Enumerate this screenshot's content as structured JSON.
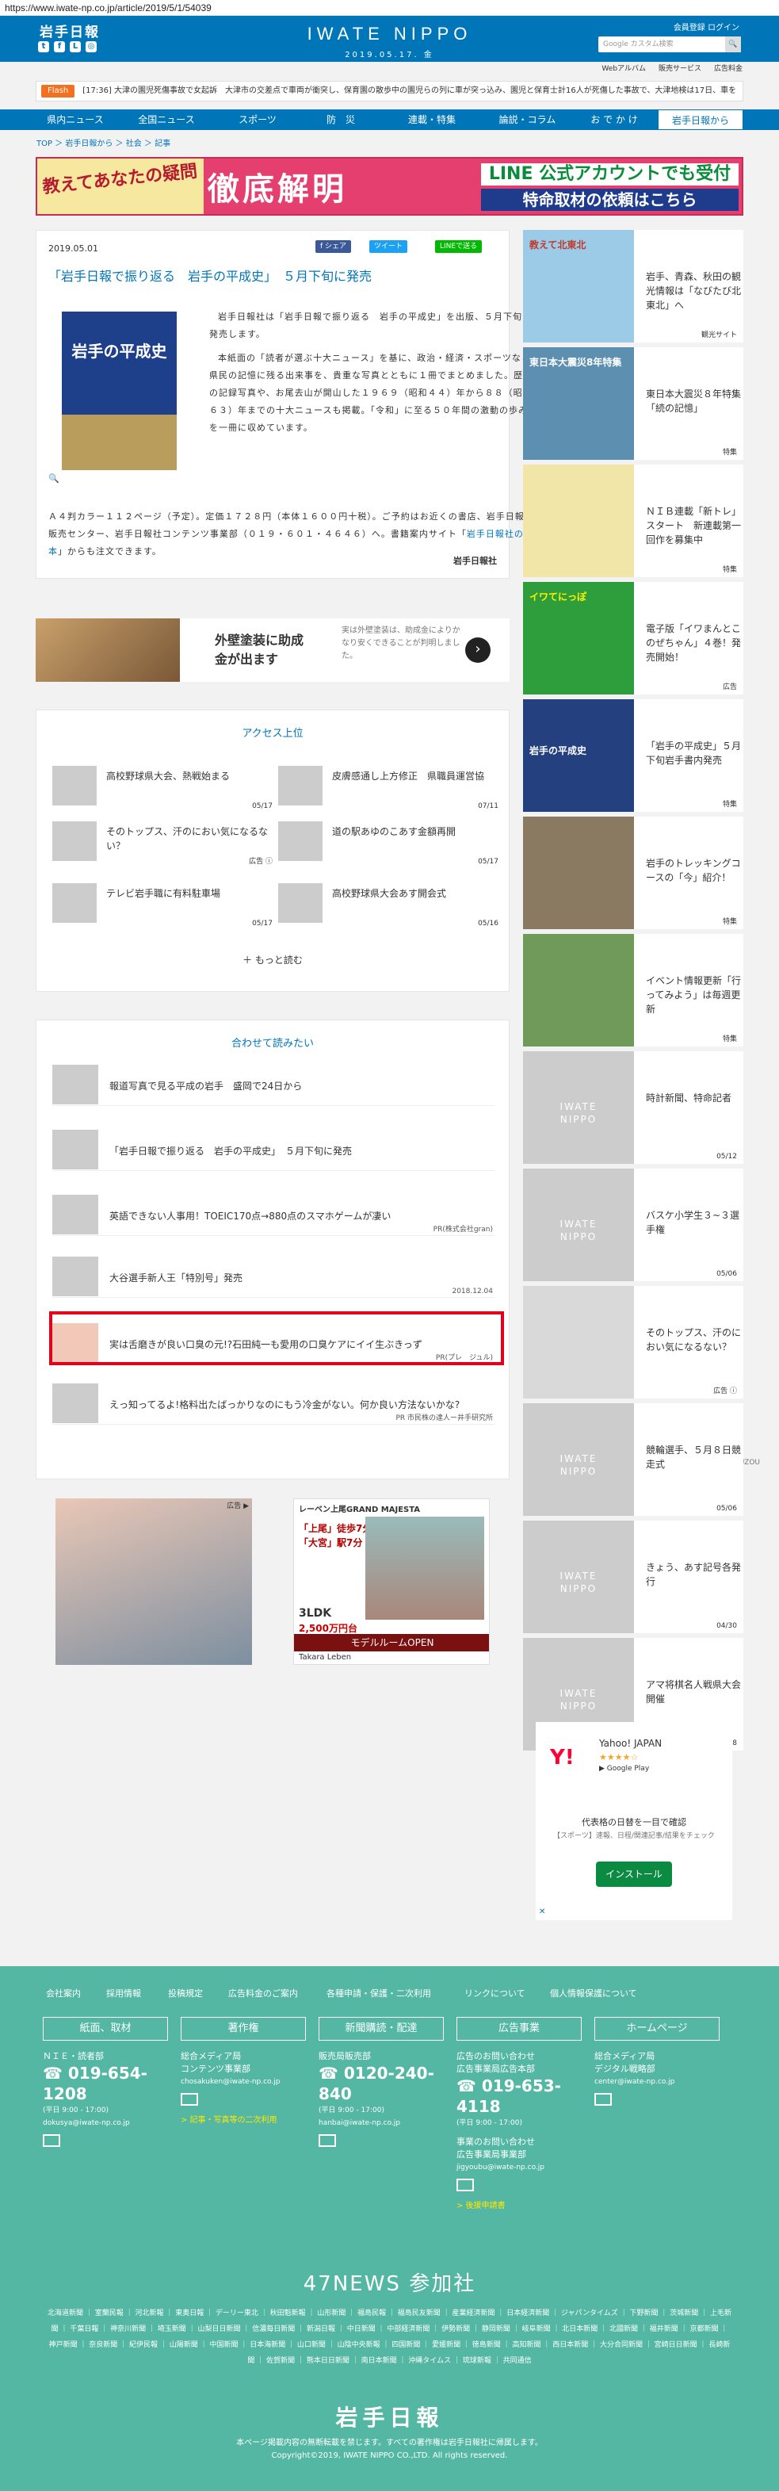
{
  "url": "https://www.iwate-np.co.jp/article/2019/5/1/54039",
  "header": {
    "logo_left": "岩手日報",
    "logo_center": "IWATE NIPPO",
    "date": "2019.05.17. 金",
    "links": "会員登録  ログイン",
    "search_placeholder": "Google カスタム検索",
    "search_btn": "🔍"
  },
  "subnav": [
    "Webアルバム",
    "販売サービス",
    "広告料金"
  ],
  "flash": {
    "label": "Flash",
    "text": "[17:36] 大津の園児死傷事故で女起訴　大津市の交差点で車両が衝突し、保育園の散歩中の園児らの列に車が突っ込み、園児と保育士計16人が死傷した事故で、大津地検は17日、車を"
  },
  "nav": [
    "県内ニュース",
    "全国ニュース",
    "スポーツ",
    "防　災",
    "連載・特集",
    "論説・コラム",
    "お で か け",
    "岩手日報から"
  ],
  "breadcrumb": "TOP ＞ 岩手日報から ＞ 社会 ＞ 記事",
  "banner": {
    "left": "教えてあなたの疑問",
    "main": "徹底解明",
    "line": "LINE 公式アカウントでも受付",
    "req": "特命取材の依頼はこちら"
  },
  "article": {
    "date": "2019.05.01",
    "share_fb": "f シェア",
    "share_tw": "ツイート",
    "share_line": "LINEで送る",
    "title": "「岩手日報で振り返る　岩手の平成史」　５月下旬に発売",
    "book_title": "岩手の平成史",
    "zoom": "🔍",
    "p1": "岩手日報社は「岩手日報で振り返る　岩手の平成史」を出版、５月下旬に発売します。",
    "p2": "本紙面の「読者が選ぶ十大ニュース」を基に、政治・経済・スポーツなど県民の記憶に残る出来事を、貴重な写真とともに１冊でまとめました。歴史の記録写真や、お尾去山が開山した１９６９（昭和４４）年から８８（昭和６３）年までの十大ニュースも掲載。「令和」に至る５０年間の激動の歩みを一冊に収めています。",
    "p3": "Ａ４判カラー１１２ページ（予定）。定価１７２８円（本体１６００円十税）。ご予約はお近くの書店、岩手日報販売センター、岩手日報社コンテンツ事業部（０１９・６０１・４６４６）へ。書籍案内サイト「",
    "p3_link": "岩手日報社の本",
    "p3_end": "」からも注文できます。",
    "sign": "岩手日報社"
  },
  "ad1": {
    "title": "外壁塗装に助成\n金が出ます",
    "desc": "実は外壁塗装は、助成金によりかなり安くできることが判明しました。",
    "arrow": "›"
  },
  "ranking": {
    "title": "アクセス上位",
    "more": "＋ もっと読む",
    "items": [
      {
        "text": "高校野球県大会、熱戦始まる",
        "date": "05/17"
      },
      {
        "text": "皮膚感通し上方修正　県職員運営協",
        "date": "07/11"
      },
      {
        "text": "そのトップス、汗のにおい気になるない？",
        "date": "広告 ⓘ"
      },
      {
        "text": "道の駅あゆのこあす金額再開",
        "date": "05/17"
      },
      {
        "text": "テレビ岩手職に有料駐車場",
        "date": "05/17"
      },
      {
        "text": "高校野球県大会あす開会式",
        "date": "05/16"
      }
    ]
  },
  "related": {
    "title": "合わせて読みたい",
    "items": [
      {
        "text": "報道写真で見る平成の岩手　盛岡で24日から",
        "date": ""
      },
      {
        "text": "「岩手日報で振り返る　岩手の平成史」　５月下旬に発売",
        "date": ""
      },
      {
        "text": "英語できない人事用！TOEIC170点→880点のスマホゲームが凄い",
        "date": "PR(株式会社gran)"
      },
      {
        "text": "大谷選手新人王「特別号」発売",
        "date": "2018.12.04"
      },
      {
        "text": "実は舌磨きが良い口臭の元!?石田純一も愛用の口臭ケアにイイ生ぶきっず",
        "date": "PR(プレ　ジュル)"
      },
      {
        "text": "えっ知ってるよ!格料出たばっかりなのにもう冷金がない。何か良い方法ないかな?",
        "date": "PR 市民株の達人ー井手研究所"
      }
    ],
    "rec": "Recommended by UZOU"
  },
  "ad2": {
    "a": "広告 ▶",
    "b": "レーベン上尾GRAND MAJESTA",
    "b1": "「上尾」徒歩7分",
    "b2": "「大宮」駅7分",
    "b3": "3LDK",
    "b4": "2,500万円台",
    "b5": "モデルルームOPEN",
    "b6": "Takara Leben"
  },
  "sidebar": [
    {
      "text": "岩手、青森、秋田の観光情報は「なびたび北東北」へ",
      "tag": "観光サイト",
      "tt": "教えて北東北"
    },
    {
      "text": "東日本大震災８年特集「続の記憶」",
      "tag": "特集",
      "tt": "東日本大震災8年特集"
    },
    {
      "text": "ＮＩＢ連載「新トレ」スタート　新連載第一回作を募集中",
      "tag": "特集",
      "tt": ""
    },
    {
      "text": "電子版「イワまんとこのぜちゃん」４巻！発売開始！",
      "tag": "広告",
      "tt": "イワてにっぽ"
    },
    {
      "text": "「岩手の平成史」５月下旬岩手書内発売",
      "tag": "特集",
      "tt": "岩手の平成史"
    },
    {
      "text": "岩手のトレッキングコースの「今」紹介！",
      "tag": "特集",
      "tt": ""
    },
    {
      "text": "イベント情報更新「行ってみよう」は毎週更新",
      "tag": "特集",
      "tt": ""
    },
    {
      "text": "時計新聞、特命記者",
      "tag": "05/12",
      "tt": ""
    },
    {
      "text": "バスケ小学生３~３選手権",
      "tag": "05/06",
      "tt": ""
    },
    {
      "text": "そのトップス、汗のにおい気になるない？",
      "tag": "広告 ⓘ",
      "tt": ""
    },
    {
      "text": "競輪選手、５月８日競走式",
      "tag": "05/06",
      "tt": ""
    },
    {
      "text": "きょう、あす記号各発行",
      "tag": "04/30",
      "tt": ""
    },
    {
      "text": "アマ将棋名人戦県大会開催",
      "tag": "04/28",
      "tt": ""
    }
  ],
  "yahoo": {
    "logo": "Y!",
    "name": "Yahoo! JAPAN",
    "stars": "★★★★☆",
    "gp": "▶ Google Play",
    "desc": "代表格の日替を一目で確認",
    "sub": "【スポーツ】速報、日程/関連記事/結果をチェック",
    "btn": "インストール",
    "x": "✕"
  },
  "footer": {
    "links": [
      "会社案内",
      "採用情報",
      "投稿規定",
      "広告料金のご案内",
      "各種申請・保護・二次利用",
      "リンクについて",
      "個人情報保護について"
    ],
    "boxes": [
      "紙面、取材",
      "著作権",
      "新聞購読・配達",
      "広告事業",
      "ホームページ"
    ],
    "c1": {
      "a": "ＮＩＥ・読者部",
      "tel": "☎ 019-654-1208",
      "hrs": "(平日 9:00 - 17:00)",
      "mail": "dokusya@iwate-np.co.jp"
    },
    "c2": {
      "a": "総合メディア局",
      "b": "コンテンツ事業部",
      "mail": "chosakuken@iwate-np.co.jp",
      "link": "> 記事・写真等の二次利用"
    },
    "c3": {
      "a": "販売局販売部",
      "tel": "☎ 0120-240-840",
      "hrs": "(平日 9:00 - 17:00)",
      "mail": "hanbai@iwate-np.co.jp"
    },
    "c4": {
      "a": "広告のお問い合わせ",
      "b": "広告事業局広告本部",
      "tel": "☎ 019-653-4118",
      "hrs": "(平日 9:00 - 17:00)",
      "c": "事業のお問い合わせ",
      "d": "広告事業局事業部",
      "mail": "jigyoubu@iwate-np.co.jp",
      "link": "> 後援申請書"
    },
    "c5": {
      "a": "総合メディア局",
      "b": "デジタル戦略部",
      "mail": "center@iwate-np.co.jp"
    },
    "f47": "47NEWS 参加社",
    "papers": "北海道新聞 ｜ 室蘭民報 ｜ 河北新報 ｜ 東奥日報 ｜ デーリー東北 ｜ 秋田魁新報 ｜ 山形新聞 ｜ 福島民報 ｜ 福島民友新聞 ｜ 産業経済新聞 ｜ 日本経済新聞 ｜ ジャパンタイムズ ｜ 下野新聞 ｜ 茨城新聞 ｜ 上毛新聞 ｜ 千葉日報 ｜ 神奈川新聞 ｜ 埼玉新聞 ｜ 山梨日日新聞 ｜ 信濃毎日新聞 ｜ 新潟日報 ｜ 中日新聞 ｜ 中部経済新聞 ｜ 伊勢新聞 ｜ 静岡新聞 ｜ 岐阜新聞 ｜ 北日本新聞 ｜ 北國新聞 ｜ 福井新聞 ｜ 京都新聞 ｜ 神戸新聞 ｜ 奈良新聞 ｜ 紀伊民報 ｜ 山陽新聞 ｜ 中国新聞 ｜ 日本海新聞 ｜ 山口新聞 ｜ 山陰中央新報 ｜ 四国新聞 ｜ 愛媛新聞 ｜ 徳島新聞 ｜ 高知新聞 ｜ 西日本新聞 ｜ 大分合同新聞 ｜ 宮崎日日新聞 ｜ 長崎新聞 ｜ 佐賀新聞 ｜ 熊本日日新聞 ｜ 南日本新聞 ｜ 沖縄タイムス ｜ 琉球新報 ｜ 共同通信",
    "logo": "岩手日報",
    "copy1": "本ページ掲載内容の無断転載を禁じます。すべての著作権は岩手日報社に帰属します。",
    "copy2": "Copyright©2019, IWATE NIPPO CO.,LTD. All rights reserved."
  },
  "colors": {
    "brand": "#0076b9",
    "footer": "#53b7a3",
    "highlight": "#e3001b"
  }
}
